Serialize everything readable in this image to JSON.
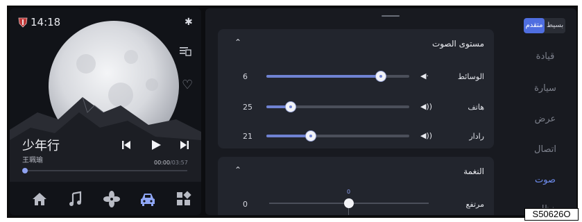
{
  "status": {
    "time": "14:18"
  },
  "media": {
    "song_title": "少年行",
    "artist": "王珮瑜",
    "elapsed": "00:00",
    "separator": "/",
    "duration": "03:57",
    "progress_fraction": 0.01
  },
  "settings": {
    "volume_card": {
      "title": "مستوى الصوت",
      "rows": [
        {
          "label": "الوسائط",
          "value": "6",
          "fraction": 0.8
        },
        {
          "label": "هاتف",
          "value": "25",
          "fraction": 0.17
        },
        {
          "label": "رادار",
          "value": "21",
          "fraction": 0.31
        }
      ]
    },
    "tone_card": {
      "title": "النغمة",
      "row_label": "مرتفع",
      "row_value": "0",
      "scale_zero": "0"
    }
  },
  "sidebar": {
    "mode_active": "متقدم",
    "mode_inactive": "بسيط",
    "items": [
      "قيادة",
      "سيارة",
      "عرض",
      "اتصال",
      "صوت",
      "نظام"
    ],
    "active_index": 4
  },
  "watermark": "S50626O",
  "colors": {
    "accent": "#4f6ee0",
    "track_fill": "#6f82d2",
    "nav_active": "#6f8ef0"
  }
}
